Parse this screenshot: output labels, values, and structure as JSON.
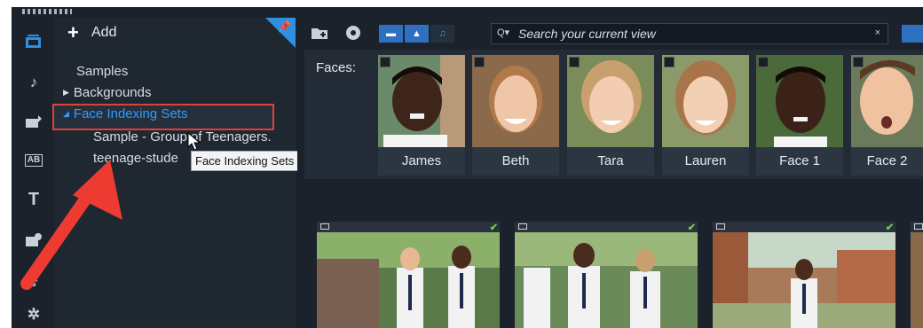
{
  "library": {
    "add_label": "Add",
    "tree": {
      "samples": "Samples",
      "backgrounds": "Backgrounds",
      "face_indexing_sets": "Face Indexing Sets",
      "child_1": "Sample - Group of Teenagers.",
      "child_2": "teenage-stude"
    },
    "tooltip": "Face Indexing Sets"
  },
  "toolbar": {
    "search_placeholder": "Search your current view",
    "clear_label": "×"
  },
  "faces": {
    "label": "Faces:",
    "items": [
      {
        "name": "James"
      },
      {
        "name": "Beth"
      },
      {
        "name": "Tara"
      },
      {
        "name": "Lauren"
      },
      {
        "name": "Face 1"
      },
      {
        "name": "Face 2"
      }
    ]
  },
  "colors": {
    "accent": "#2f8fe0",
    "highlight_box": "#e0403a",
    "annotation_arrow": "#ee3b32"
  }
}
